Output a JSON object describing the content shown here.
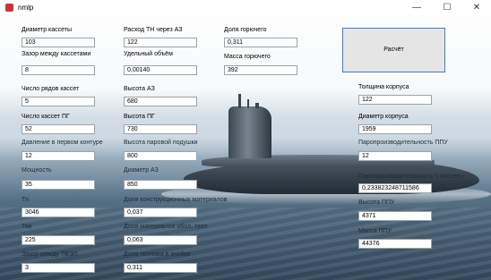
{
  "window": {
    "title": "nmlp",
    "minimize": "—",
    "maximize": "☐",
    "close": "✕"
  },
  "buttons": {
    "calc": "Расчёт"
  },
  "col1": [
    {
      "label": "Диаметр кассеты",
      "value": "103"
    },
    {
      "label": "Зазор между кассетами",
      "value": "8"
    },
    {
      "label": "Число рядов кассет",
      "value": "5"
    },
    {
      "label": "Число кассет ПГ",
      "value": "52"
    },
    {
      "label": "Давление в первом контуре",
      "value": "12"
    },
    {
      "label": "Мощность",
      "value": "35"
    },
    {
      "label": "Tп",
      "value": "3046"
    },
    {
      "label": "Твв",
      "value": "225"
    },
    {
      "label": "Зазор между ТВЭЛ",
      "value": "3"
    }
  ],
  "col2": [
    {
      "label": "Расход ТН через АЗ",
      "value": "122"
    },
    {
      "label": "Удельный объём",
      "value": "0,00140"
    },
    {
      "label": "Высота АЗ",
      "value": "680"
    },
    {
      "label": "Высота ПГ",
      "value": "730"
    },
    {
      "label": "Высота паровой подушки",
      "value": "800"
    },
    {
      "label": "Диаметр АЗ",
      "value": "850"
    },
    {
      "label": "Доля конструкционных материалов",
      "value": "0,037"
    },
    {
      "label": "Доля материалов обол. твэл",
      "value": "0,063"
    },
    {
      "label": "Доля топлива в ячейке",
      "value": "0,311"
    }
  ],
  "col3": [
    {
      "label": "Доля горючего",
      "value": "0,311"
    },
    {
      "label": "Масса горючего",
      "value": "392"
    }
  ],
  "col4": [
    {
      "label": "Толщина корпуса",
      "value": "122"
    },
    {
      "label": "Диаметр корпуса",
      "value": "1959"
    },
    {
      "label": "Паропроизводительность ППУ",
      "value": "12"
    },
    {
      "label": "Паропроизводительность 1 кассеты",
      "value": "0,233823248711586"
    },
    {
      "label": "Высота ППУ",
      "value": "4371"
    },
    {
      "label": "Масса ППУ",
      "value": "44376"
    }
  ]
}
